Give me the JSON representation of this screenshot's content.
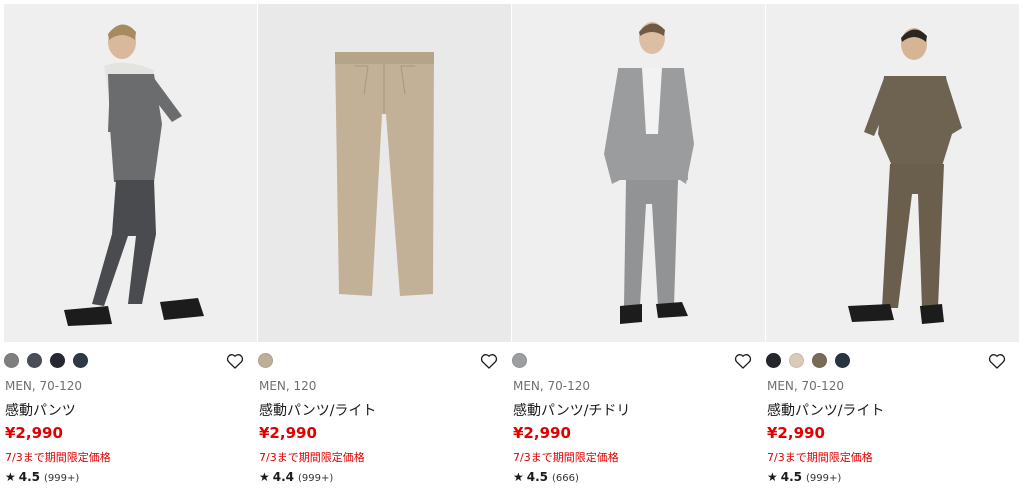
{
  "products": [
    {
      "image_alt": "model-walking-dark-gray-pants",
      "swatches": [
        "#7f7f7f",
        "#4a4e57",
        "#262a30",
        "#2d3a45"
      ],
      "meta": "MEN, 70-120",
      "name": "感動パンツ",
      "price": "¥2,990",
      "promo": "7/3まで期間限定価格",
      "star": "★",
      "rating": "4.5",
      "count": "(999+)"
    },
    {
      "image_alt": "beige-pants-flat",
      "swatches": [
        "#bfae98"
      ],
      "meta": "MEN, 120",
      "name": "感動パンツ/ライト",
      "price": "¥2,990",
      "promo": "7/3まで期間限定価格",
      "star": "★",
      "rating": "4.4",
      "count": "(999+)"
    },
    {
      "image_alt": "model-gray-check-suit",
      "swatches": [
        "#9c9ea0"
      ],
      "meta": "MEN, 70-120",
      "name": "感動パンツ/チドリ",
      "price": "¥2,990",
      "promo": "7/3まで期間限定価格",
      "star": "★",
      "rating": "4.5",
      "count": "(666)"
    },
    {
      "image_alt": "model-olive-polo-pants",
      "swatches": [
        "#23262b",
        "#d9cbb7",
        "#7a6a58",
        "#2a3342"
      ],
      "meta": "MEN, 70-120",
      "name": "感動パンツ/ライト",
      "price": "¥2,990",
      "promo": "7/3まで期間限定価格",
      "star": "★",
      "rating": "4.5",
      "count": "(999+)"
    }
  ],
  "colors": {
    "price_red": "#e00000",
    "meta_gray": "#6f6f6f"
  },
  "icons": {
    "favorite": "heart-outline-icon",
    "rating": "star-icon"
  }
}
